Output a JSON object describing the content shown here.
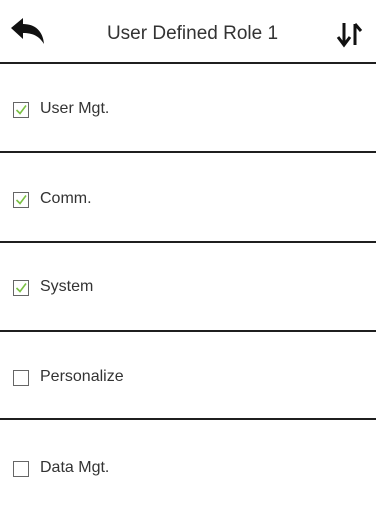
{
  "header": {
    "title": "User Defined Role 1",
    "back_icon": "back-arrow-icon",
    "sort_icon": "sort-arrows-icon"
  },
  "colors": {
    "check": "#7ac143",
    "divider": "#1f1f1f",
    "text": "#333333"
  },
  "permissions": [
    {
      "label": "User Mgt.",
      "checked": true
    },
    {
      "label": "Comm.",
      "checked": true
    },
    {
      "label": "System",
      "checked": true
    },
    {
      "label": "Personalize",
      "checked": false
    },
    {
      "label": "Data Mgt.",
      "checked": false
    }
  ]
}
